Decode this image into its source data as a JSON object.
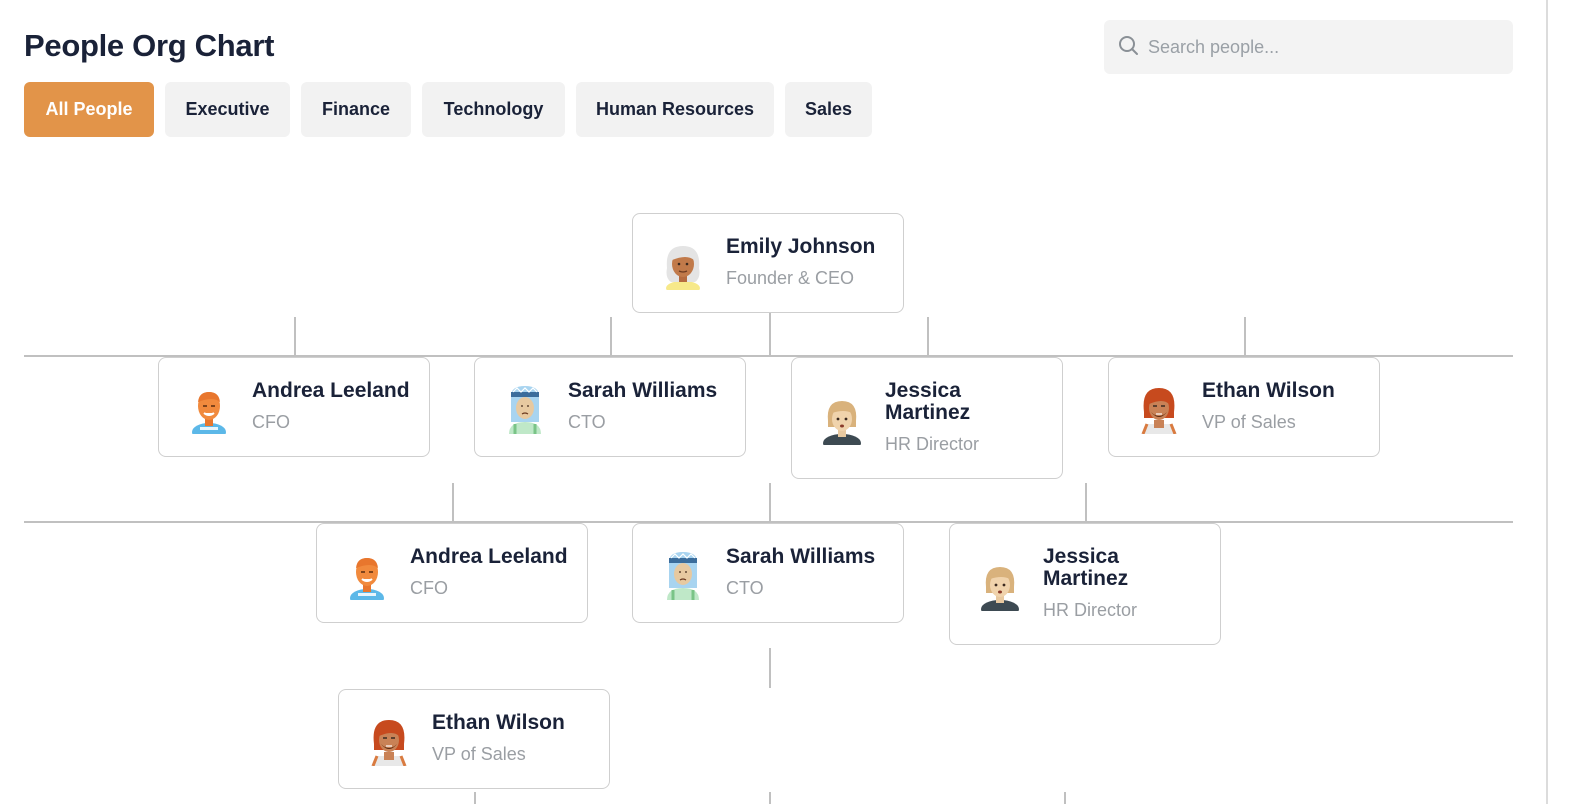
{
  "header": {
    "title": "People Org Chart",
    "search_placeholder": "Search people..."
  },
  "tabs": [
    {
      "label": "All People",
      "active": true
    },
    {
      "label": "Executive",
      "active": false
    },
    {
      "label": "Finance",
      "active": false
    },
    {
      "label": "Technology",
      "active": false
    },
    {
      "label": "Human Resources",
      "active": false
    },
    {
      "label": "Sales",
      "active": false
    }
  ],
  "colors": {
    "accent": "#e29449",
    "tab_bg": "#f2f2f2",
    "text_primary": "#1a2238",
    "text_muted": "#9a9ea3",
    "connector": "#c0c0c0"
  },
  "people": {
    "ceo": {
      "name": "Emily Johnson",
      "role": "Founder & CEO",
      "avatar": "avatar-white-hair-woman"
    },
    "level1": [
      {
        "name": "Andrea Leeland",
        "role": "CFO",
        "avatar": "avatar-orange-resist"
      },
      {
        "name": "Sarah Williams",
        "role": "CTO",
        "avatar": "avatar-blue-hat"
      },
      {
        "name": "Jessica Martinez",
        "role": "HR Director",
        "avatar": "avatar-blonde-bob"
      },
      {
        "name": "Ethan Wilson",
        "role": "VP of Sales",
        "avatar": "avatar-red-hair-beard"
      }
    ],
    "level2": [
      {
        "name": "Andrea Leeland",
        "role": "CFO",
        "avatar": "avatar-orange-resist"
      },
      {
        "name": "Sarah Williams",
        "role": "CTO",
        "avatar": "avatar-blue-hat"
      },
      {
        "name": "Jessica Martinez",
        "role": "HR Director",
        "avatar": "avatar-blonde-bob"
      }
    ],
    "level3": [
      {
        "name": "Ethan Wilson",
        "role": "VP of Sales",
        "avatar": "avatar-red-hair-beard"
      }
    ]
  }
}
